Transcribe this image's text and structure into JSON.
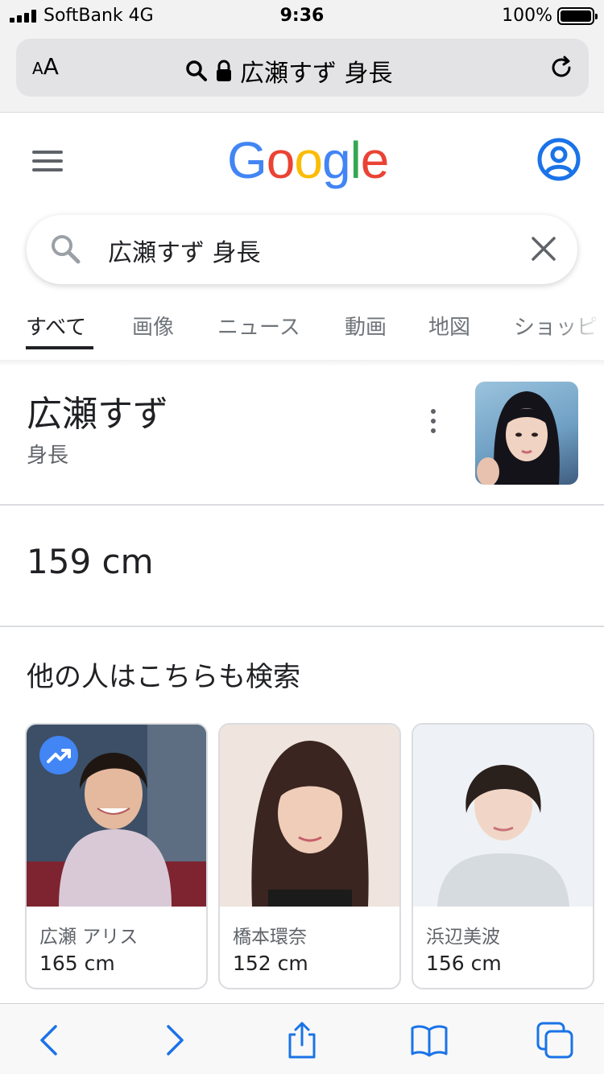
{
  "status_bar": {
    "carrier": "SoftBank 4G",
    "time": "9:36",
    "battery": "100%"
  },
  "safari": {
    "aa_label_small": "A",
    "aa_label_large": "A",
    "url": "広瀬すず 身長"
  },
  "google": {
    "logo_letters": [
      "G",
      "o",
      "o",
      "g",
      "l",
      "e"
    ],
    "logo_colors": [
      "#4285F4",
      "#EA4335",
      "#FBBC05",
      "#4285F4",
      "#34A853",
      "#EA4335"
    ],
    "search_query": "広瀬すず 身長",
    "tabs": [
      "すべて",
      "画像",
      "ニュース",
      "動画",
      "地図",
      "ショッピ"
    ],
    "active_tab": "すべて"
  },
  "knowledge": {
    "title": "広瀬すず",
    "subtitle": "身長",
    "answer": "159 cm"
  },
  "related": {
    "heading": "他の人はこちらも検索",
    "cards": [
      {
        "name": "広瀬 アリス",
        "value": "165 cm",
        "trending": true
      },
      {
        "name": "橋本環奈",
        "value": "152 cm",
        "trending": false
      },
      {
        "name": "浜辺美波",
        "value": "156 cm",
        "trending": false
      }
    ]
  },
  "colors": {
    "accent_blue": "#4285F4",
    "safari_blue": "#1a73e8",
    "text_primary": "#202124",
    "text_secondary": "#5f6368"
  },
  "icons": {
    "menu": "hamburger-menu-icon",
    "account": "account-circle-icon",
    "search": "search-icon",
    "clear": "close-icon",
    "more": "more-vert-icon",
    "trending": "trending-up-icon",
    "toolbar": [
      "back-arrow-icon",
      "forward-arrow-icon",
      "share-icon",
      "bookmarks-icon",
      "tabs-icon"
    ]
  }
}
